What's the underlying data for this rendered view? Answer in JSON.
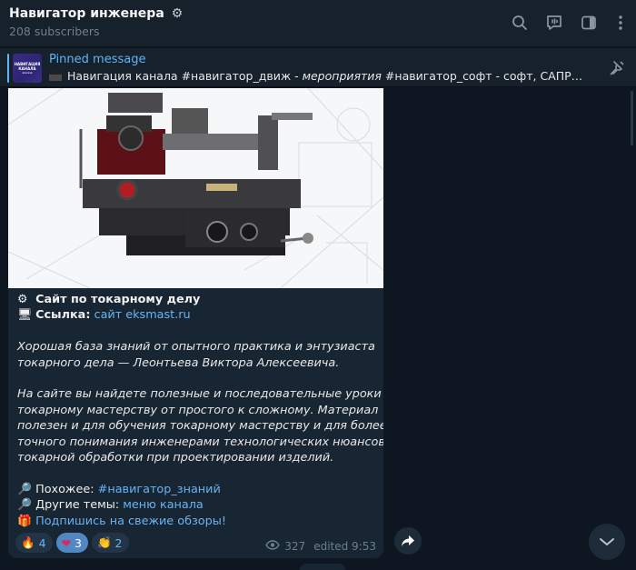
{
  "channel": {
    "title": "Навигатор инженера",
    "title_emoji": "⚙",
    "subscribers": "208 subscribers"
  },
  "header_icons": [
    "search-icon",
    "voice-chat-icon",
    "sidebar-toggle-icon",
    "more-menu-icon"
  ],
  "pinned": {
    "label": "Pinned message",
    "thumbnail_text": "НАВИГАЦИЯ КАНАЛА",
    "preview_prefix": "Навигация канала  #навигатор_движ - ",
    "preview_italic": "мероприятия",
    "preview_suffix": " #навигатор_софт - софт, САПР #навигат..."
  },
  "post": {
    "heading": "Сайт по токарному делу",
    "link_label": "Ссылка:",
    "link_text": "сайт eksmast.ru",
    "paragraph1": [
      "Хорошая база знаний от опытного практика и энтузиаста",
      "токарного дела — Леонтьева Виктора Алексеевича."
    ],
    "paragraph2": [
      "На сайте вы найдете полезные и последовательные уроки по",
      "токарному мастерству от простого к сложному. Материал",
      "полезен и для обучения токарному мастерству и для более",
      "точного понимания инженерами технологических нюансов",
      "токарной обработки при проектировании изделий."
    ],
    "similar_label": "Похожее:",
    "similar_tag": "#навигатор_знаний",
    "other_label": "Другие темы:",
    "other_link": "меню канала",
    "subscribe_link": "Подпишись на свежие обзоры!",
    "reactions": [
      {
        "emoji": "🔥",
        "count": "4",
        "active": false
      },
      {
        "emoji": "❤",
        "count": "3",
        "active": true
      },
      {
        "emoji": "👏",
        "count": "2",
        "active": false
      }
    ],
    "views": "327",
    "edited": "edited 9:53"
  },
  "colors": {
    "background": "#0e1621",
    "header": "#17212b",
    "bubble": "#182533",
    "link": "#6ab3f3",
    "muted": "#6d7f8f",
    "reaction_active": "#5288c1"
  }
}
